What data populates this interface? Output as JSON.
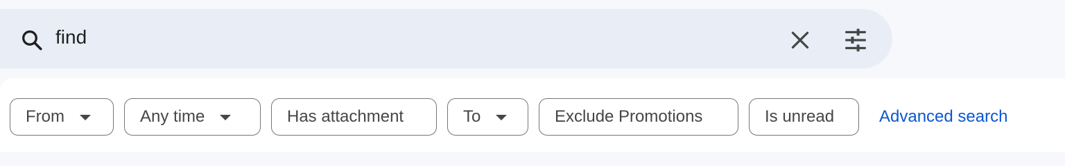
{
  "search": {
    "value": "find",
    "search_icon": "search-icon",
    "clear_icon": "close-icon",
    "options_icon": "tune-icon"
  },
  "filters": {
    "chips": [
      {
        "label": "From",
        "has_dropdown": true
      },
      {
        "label": "Any time",
        "has_dropdown": true
      },
      {
        "label": "Has attachment",
        "has_dropdown": false
      },
      {
        "label": "To",
        "has_dropdown": true
      },
      {
        "label": "Exclude Promotions",
        "has_dropdown": false
      },
      {
        "label": "Is unread",
        "has_dropdown": false
      }
    ],
    "advanced_search_label": "Advanced search"
  },
  "colors": {
    "search_bar_bg": "#e9eef6",
    "page_bg": "#f6f8fc",
    "chip_border": "#747775",
    "chip_text": "#444746",
    "link": "#0b57d0"
  }
}
